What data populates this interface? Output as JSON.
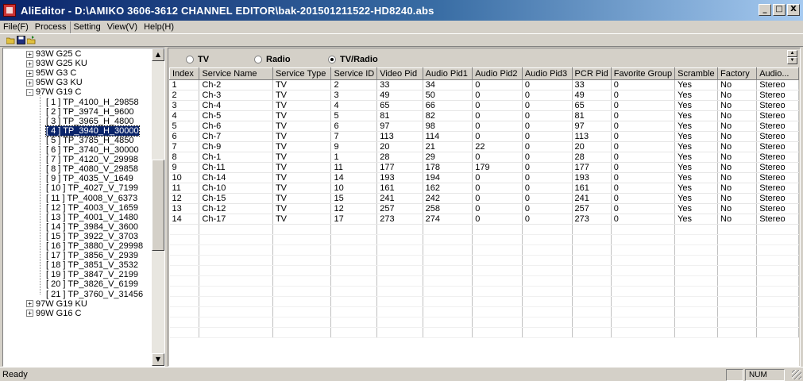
{
  "window": {
    "title": "AliEditor - D:\\AMIKO 3606-3612 CHANNEL EDITOR\\bak-201501211522-HD8240.abs",
    "minimize": "_",
    "maximize": "□",
    "close": "X"
  },
  "menu": [
    "File(F)",
    "Process",
    "Setting",
    "View(V)",
    "Help(H)"
  ],
  "tree": {
    "items": [
      {
        "label": "93W G25 C",
        "sign": "+"
      },
      {
        "label": "93W G25 KU",
        "sign": "+"
      },
      {
        "label": "95W G3 C",
        "sign": "+"
      },
      {
        "label": "95W G3 KU",
        "sign": "+"
      },
      {
        "label": "97W G19 C",
        "sign": "-"
      }
    ],
    "children": [
      "[ 1 ]  TP_4100_H_29858",
      "[ 2 ]  TP_3974_H_9600",
      "[ 3 ]  TP_3965_H_4800",
      "[ 4 ]  TP_3940_H_30000",
      "[ 5 ]  TP_3785_H_4850",
      "[ 6 ]  TP_3740_H_30000",
      "[ 7 ]  TP_4120_V_29998",
      "[ 8 ]  TP_4080_V_29858",
      "[ 9 ]  TP_4035_V_1649",
      "[ 10 ]  TP_4027_V_7199",
      "[ 11 ]  TP_4008_V_6373",
      "[ 12 ]  TP_4003_V_1659",
      "[ 13 ]  TP_4001_V_1480",
      "[ 14 ]  TP_3984_V_3600",
      "[ 15 ]  TP_3922_V_3703",
      "[ 16 ]  TP_3880_V_29998",
      "[ 17 ]  TP_3856_V_2939",
      "[ 18 ]  TP_3851_V_3532",
      "[ 19 ]  TP_3847_V_2199",
      "[ 20 ]  TP_3826_V_6199",
      "[ 21 ]  TP_3760_V_31456"
    ],
    "selected_child": 3,
    "after": [
      {
        "label": "97W G19 KU",
        "sign": "+"
      },
      {
        "label": "99W G16 C",
        "sign": "+"
      }
    ]
  },
  "filter": {
    "options": [
      "TV",
      "Radio",
      "TV/Radio"
    ],
    "selected": 2
  },
  "table": {
    "columns": [
      "Index",
      "Service Name",
      "Service Type",
      "Service ID",
      "Video Pid",
      "Audio Pid1",
      "Audio Pid2",
      "Audio Pid3",
      "PCR Pid",
      "Favorite Group",
      "Scramble",
      "Factory",
      "Audio..."
    ],
    "rows": [
      [
        "1",
        "Ch-2",
        "TV",
        "2",
        "33",
        "34",
        "0",
        "0",
        "33",
        "0",
        "Yes",
        "No",
        "Stereo"
      ],
      [
        "2",
        "Ch-3",
        "TV",
        "3",
        "49",
        "50",
        "0",
        "0",
        "49",
        "0",
        "Yes",
        "No",
        "Stereo"
      ],
      [
        "3",
        "Ch-4",
        "TV",
        "4",
        "65",
        "66",
        "0",
        "0",
        "65",
        "0",
        "Yes",
        "No",
        "Stereo"
      ],
      [
        "4",
        "Ch-5",
        "TV",
        "5",
        "81",
        "82",
        "0",
        "0",
        "81",
        "0",
        "Yes",
        "No",
        "Stereo"
      ],
      [
        "5",
        "Ch-6",
        "TV",
        "6",
        "97",
        "98",
        "0",
        "0",
        "97",
        "0",
        "Yes",
        "No",
        "Stereo"
      ],
      [
        "6",
        "Ch-7",
        "TV",
        "7",
        "113",
        "114",
        "0",
        "0",
        "113",
        "0",
        "Yes",
        "No",
        "Stereo"
      ],
      [
        "7",
        "Ch-9",
        "TV",
        "9",
        "20",
        "21",
        "22",
        "0",
        "20",
        "0",
        "Yes",
        "No",
        "Stereo"
      ],
      [
        "8",
        "Ch-1",
        "TV",
        "1",
        "28",
        "29",
        "0",
        "0",
        "28",
        "0",
        "Yes",
        "No",
        "Stereo"
      ],
      [
        "9",
        "Ch-11",
        "TV",
        "11",
        "177",
        "178",
        "179",
        "0",
        "177",
        "0",
        "Yes",
        "No",
        "Stereo"
      ],
      [
        "10",
        "Ch-14",
        "TV",
        "14",
        "193",
        "194",
        "0",
        "0",
        "193",
        "0",
        "Yes",
        "No",
        "Stereo"
      ],
      [
        "11",
        "Ch-10",
        "TV",
        "10",
        "161",
        "162",
        "0",
        "0",
        "161",
        "0",
        "Yes",
        "No",
        "Stereo"
      ],
      [
        "12",
        "Ch-15",
        "TV",
        "15",
        "241",
        "242",
        "0",
        "0",
        "241",
        "0",
        "Yes",
        "No",
        "Stereo"
      ],
      [
        "13",
        "Ch-12",
        "TV",
        "12",
        "257",
        "258",
        "0",
        "0",
        "257",
        "0",
        "Yes",
        "No",
        "Stereo"
      ],
      [
        "14",
        "Ch-17",
        "TV",
        "17",
        "273",
        "274",
        "0",
        "0",
        "273",
        "0",
        "Yes",
        "No",
        "Stereo"
      ]
    ]
  },
  "status": {
    "text": "Ready",
    "num": "NUM"
  },
  "colors": {
    "selection": "#0a246a",
    "titlebar_start": "#0a246a",
    "face": "#d4d0c8"
  }
}
